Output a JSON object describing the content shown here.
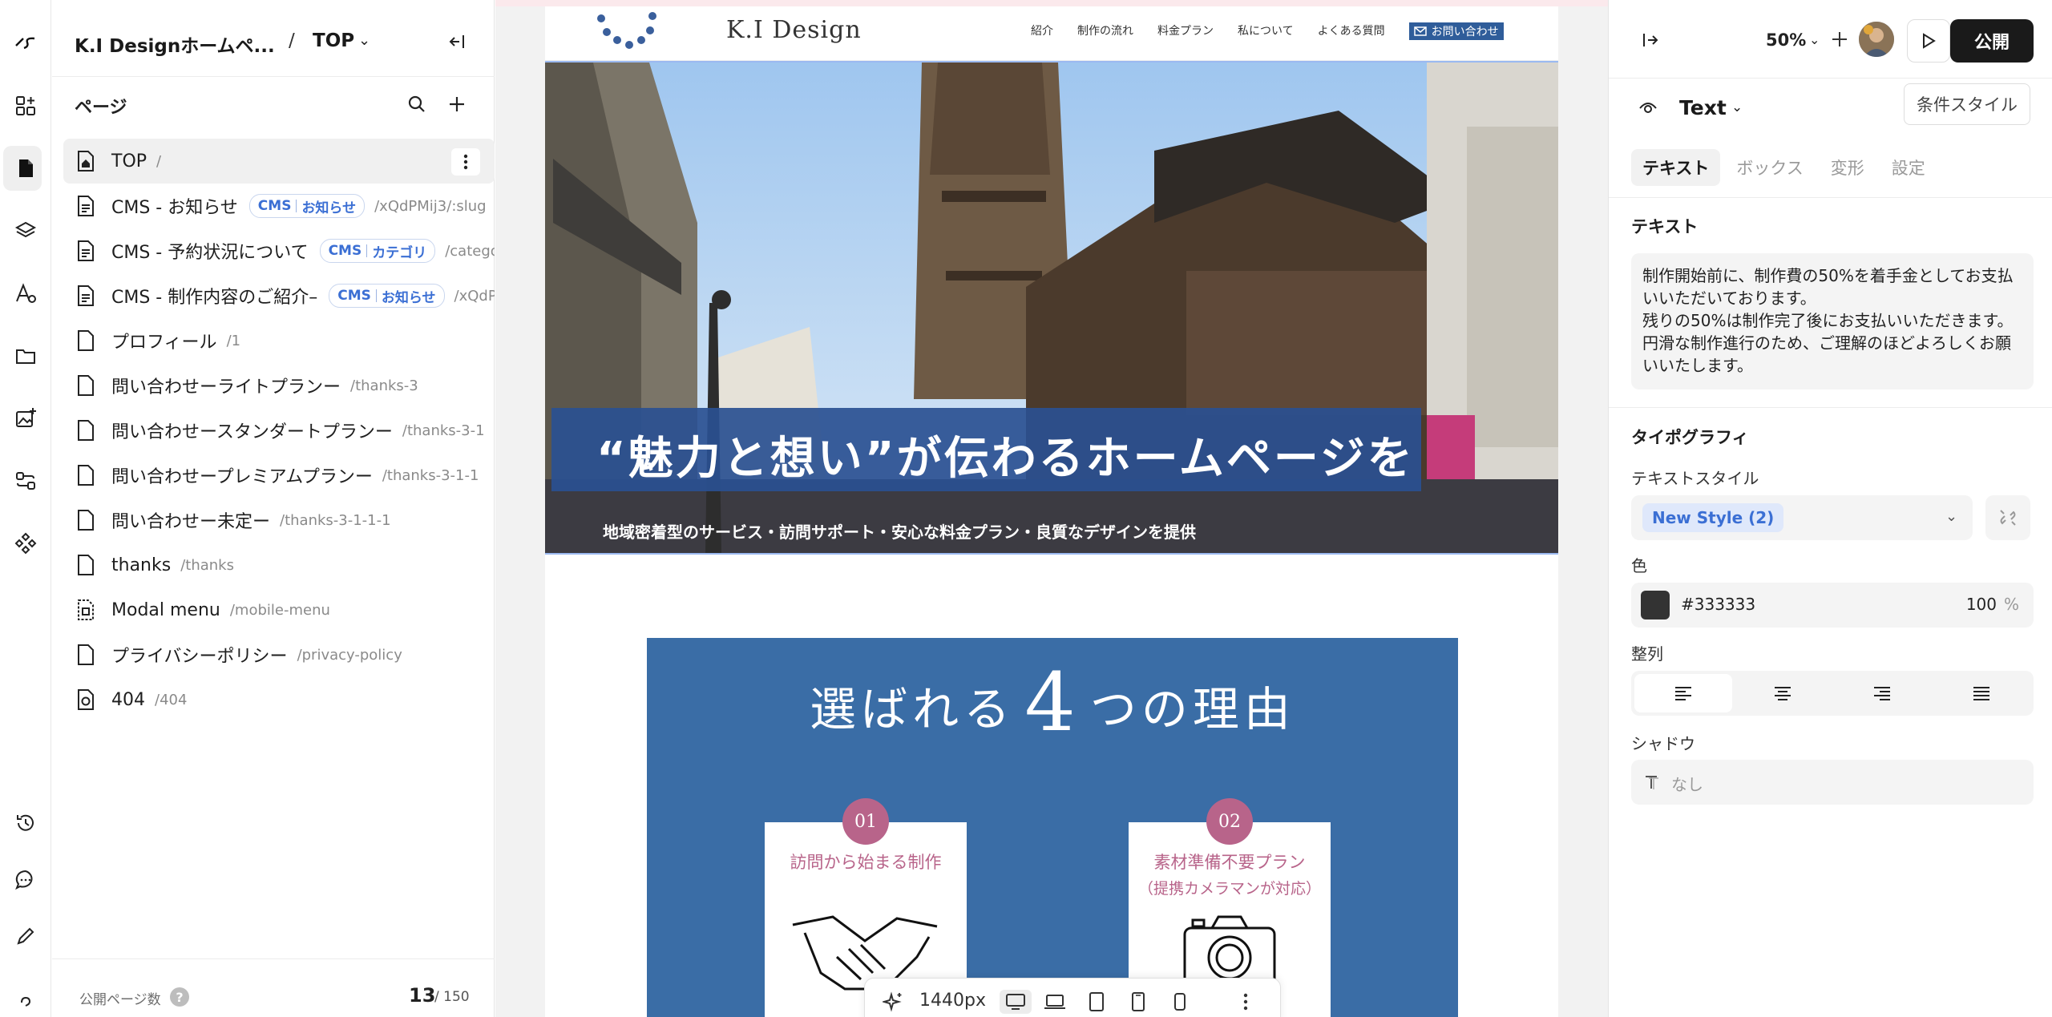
{
  "left_panel": {
    "site_name": "K.I Designホームペ...",
    "breadcrumb_sep": "/",
    "current_page": "TOP",
    "pages_heading": "ページ",
    "pages": [
      {
        "name": "TOP",
        "path": "/",
        "icon": "home-page-icon",
        "active": true
      },
      {
        "name": "CMS - お知らせ",
        "badge": [
          "CMS",
          "お知らせ"
        ],
        "path": "/xQdPMij3/:slug",
        "icon": "cms-page-icon"
      },
      {
        "name": "CMS - 予約状況について",
        "badge": [
          "CMS",
          "カテゴリ"
        ],
        "path": "/categor",
        "icon": "cms-page-icon"
      },
      {
        "name": "CMS - 制作内容のご紹介–",
        "badge": [
          "CMS",
          "お知らせ"
        ],
        "path": "/xQdPl",
        "icon": "cms-page-icon"
      },
      {
        "name": "プロフィール",
        "path": "/1",
        "icon": "page-icon"
      },
      {
        "name": "問い合わせーライトプランー",
        "path": "/thanks-3",
        "icon": "page-icon"
      },
      {
        "name": "問い合わせースタンダートプランー",
        "path": "/thanks-3-1",
        "icon": "page-icon"
      },
      {
        "name": "問い合わせープレミアムプランー",
        "path": "/thanks-3-1-1",
        "icon": "page-icon"
      },
      {
        "name": "問い合わせー未定ー",
        "path": "/thanks-3-1-1-1",
        "icon": "page-icon"
      },
      {
        "name": "thanks",
        "path": "/thanks",
        "icon": "page-icon"
      },
      {
        "name": "Modal menu",
        "path": "/mobile-menu",
        "icon": "modal-page-icon"
      },
      {
        "name": "プライバシーポリシー",
        "path": "/privacy-policy",
        "icon": "page-icon"
      },
      {
        "name": "404",
        "path": "/404",
        "icon": "error-page-icon"
      }
    ],
    "footer": {
      "label": "公開ページ数",
      "help": "?",
      "count": "13",
      "total": "/ 150"
    }
  },
  "site": {
    "brand": "K.I Design",
    "nav": [
      "紹介",
      "制作の流れ",
      "料金プラン",
      "私について",
      "よくある質問"
    ],
    "nav_contact": "お問い合わせ",
    "hero_title": "“魅力と想い”が伝わるホームページを",
    "hero_sub": "地域密着型のサービス・訪問サポート・安心な料金プラン・良質なデザインを提供",
    "reasons_title_pre": "選ばれる",
    "reasons_title_num": "4",
    "reasons_title_post": "つの理由",
    "cards": [
      {
        "num": "01",
        "title_lines": [
          "訪問から始まる制作"
        ]
      },
      {
        "num": "02",
        "title_lines": [
          "素材準備不要プラン",
          "（提携カメラマンが対応）"
        ]
      }
    ]
  },
  "canvas_toolbar": {
    "width_value": "1440px",
    "selected_device": "desktop"
  },
  "right_panel": {
    "zoom": "50%",
    "publish": "公開",
    "element_type": "Text",
    "condition_style": "条件スタイル",
    "tabs": [
      "テキスト",
      "ボックス",
      "変形",
      "設定"
    ],
    "active_tab": "テキスト",
    "text_section": "テキスト",
    "text_content": "制作開始前に、制作費の50%を着手金としてお支払いいただいております。\n残りの50%は制作完了後にお支払いいただきます。円滑な制作進行のため、ご理解のほどよろしくお願いいたします。",
    "typography_section": "タイポグラフィ",
    "text_style_label": "テキストスタイル",
    "text_style_value": "New Style (2)",
    "color_label": "色",
    "color_hex": "#333333",
    "color_opacity": "100",
    "color_unit": "%",
    "align_label": "整列",
    "align_selected": "left",
    "shadow_label": "シャドウ",
    "shadow_value": "なし"
  },
  "colors": {
    "accent_blue": "#3a6da6",
    "hero_band": "#2a5091",
    "badge_pink": "#b8648a",
    "cms_badge": "#3b6fd4"
  }
}
